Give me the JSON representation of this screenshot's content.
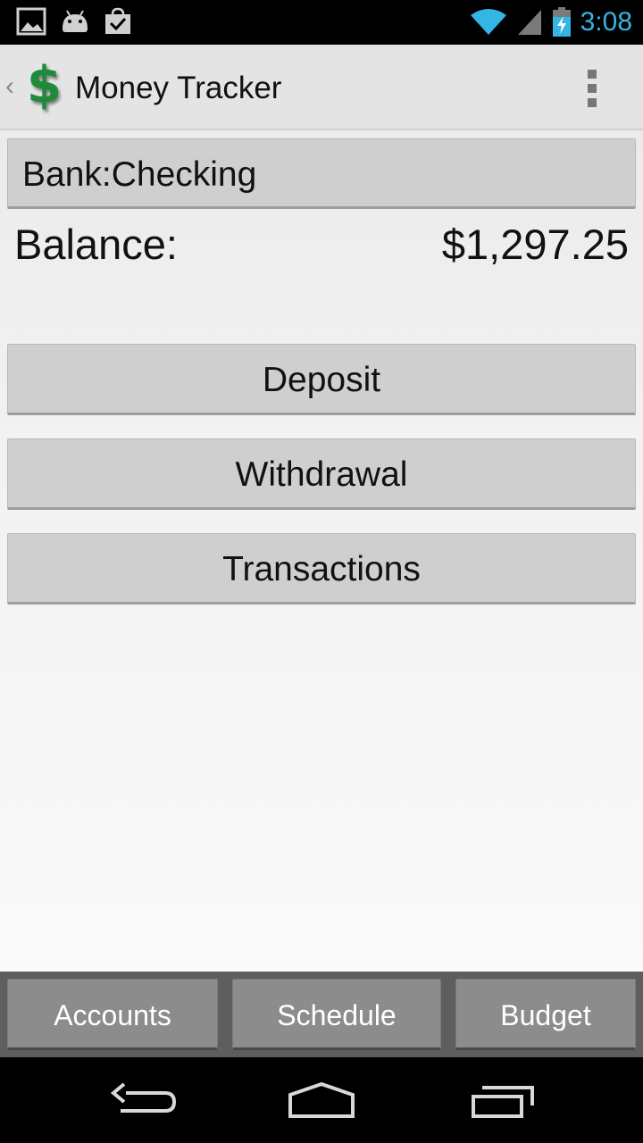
{
  "status_bar": {
    "time": "3:08",
    "icons": [
      "image-icon",
      "android-icon",
      "shopping-bag-check-icon",
      "wifi-icon",
      "signal-icon",
      "battery-charging-icon"
    ]
  },
  "action_bar": {
    "title": "Money Tracker",
    "logo_glyph": "$",
    "up_glyph": "‹"
  },
  "account": {
    "selected": "Bank:Checking"
  },
  "balance": {
    "label": "Balance:",
    "value": "$1,297.25"
  },
  "actions": {
    "deposit": "Deposit",
    "withdrawal": "Withdrawal",
    "transactions": "Transactions"
  },
  "tabs": {
    "accounts": "Accounts",
    "schedule": "Schedule",
    "budget": "Budget"
  },
  "nav": {
    "icons": [
      "back-icon",
      "home-icon",
      "recent-apps-icon"
    ]
  },
  "colors": {
    "status_time": "#33b5e5",
    "logo_green": "#1e8a3a",
    "tab_bar_bg": "#5e5e5e"
  }
}
